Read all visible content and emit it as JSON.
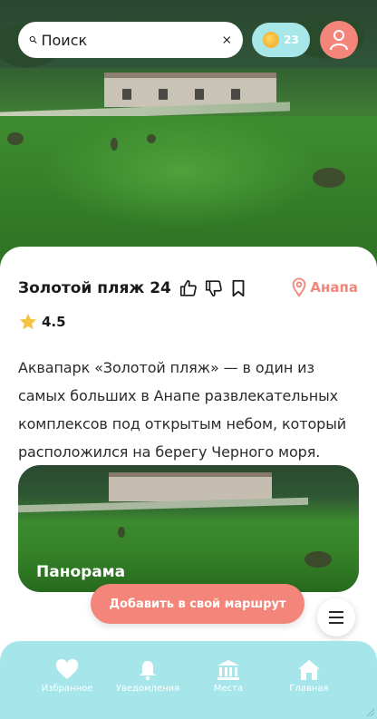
{
  "search": {
    "placeholder": "Поиск"
  },
  "coins": {
    "count": "23"
  },
  "place": {
    "title": "Золотой пляж 24",
    "city": "Анапа",
    "rating": "4.5",
    "description": "Аквапарк «Золотой пляж» — в один из самых больших в Анапе развлекательных комплексов под открытым небом, который расположился на берегу Черного моря."
  },
  "panorama": {
    "label": "Панорама"
  },
  "actions": {
    "add_route_label": "Добавить в свой маршрут"
  },
  "nav": {
    "items": [
      {
        "label": "Избранное",
        "icon": "heart-icon"
      },
      {
        "label": "Уведомления",
        "icon": "bell-icon"
      },
      {
        "label": "Места",
        "icon": "museum-icon"
      },
      {
        "label": "Главная",
        "icon": "home-icon"
      }
    ]
  },
  "colors": {
    "accent": "#f3857a",
    "nav_bg": "#a6e6ea",
    "coins_bg": "#a7e7ea",
    "star": "#f5c242"
  }
}
